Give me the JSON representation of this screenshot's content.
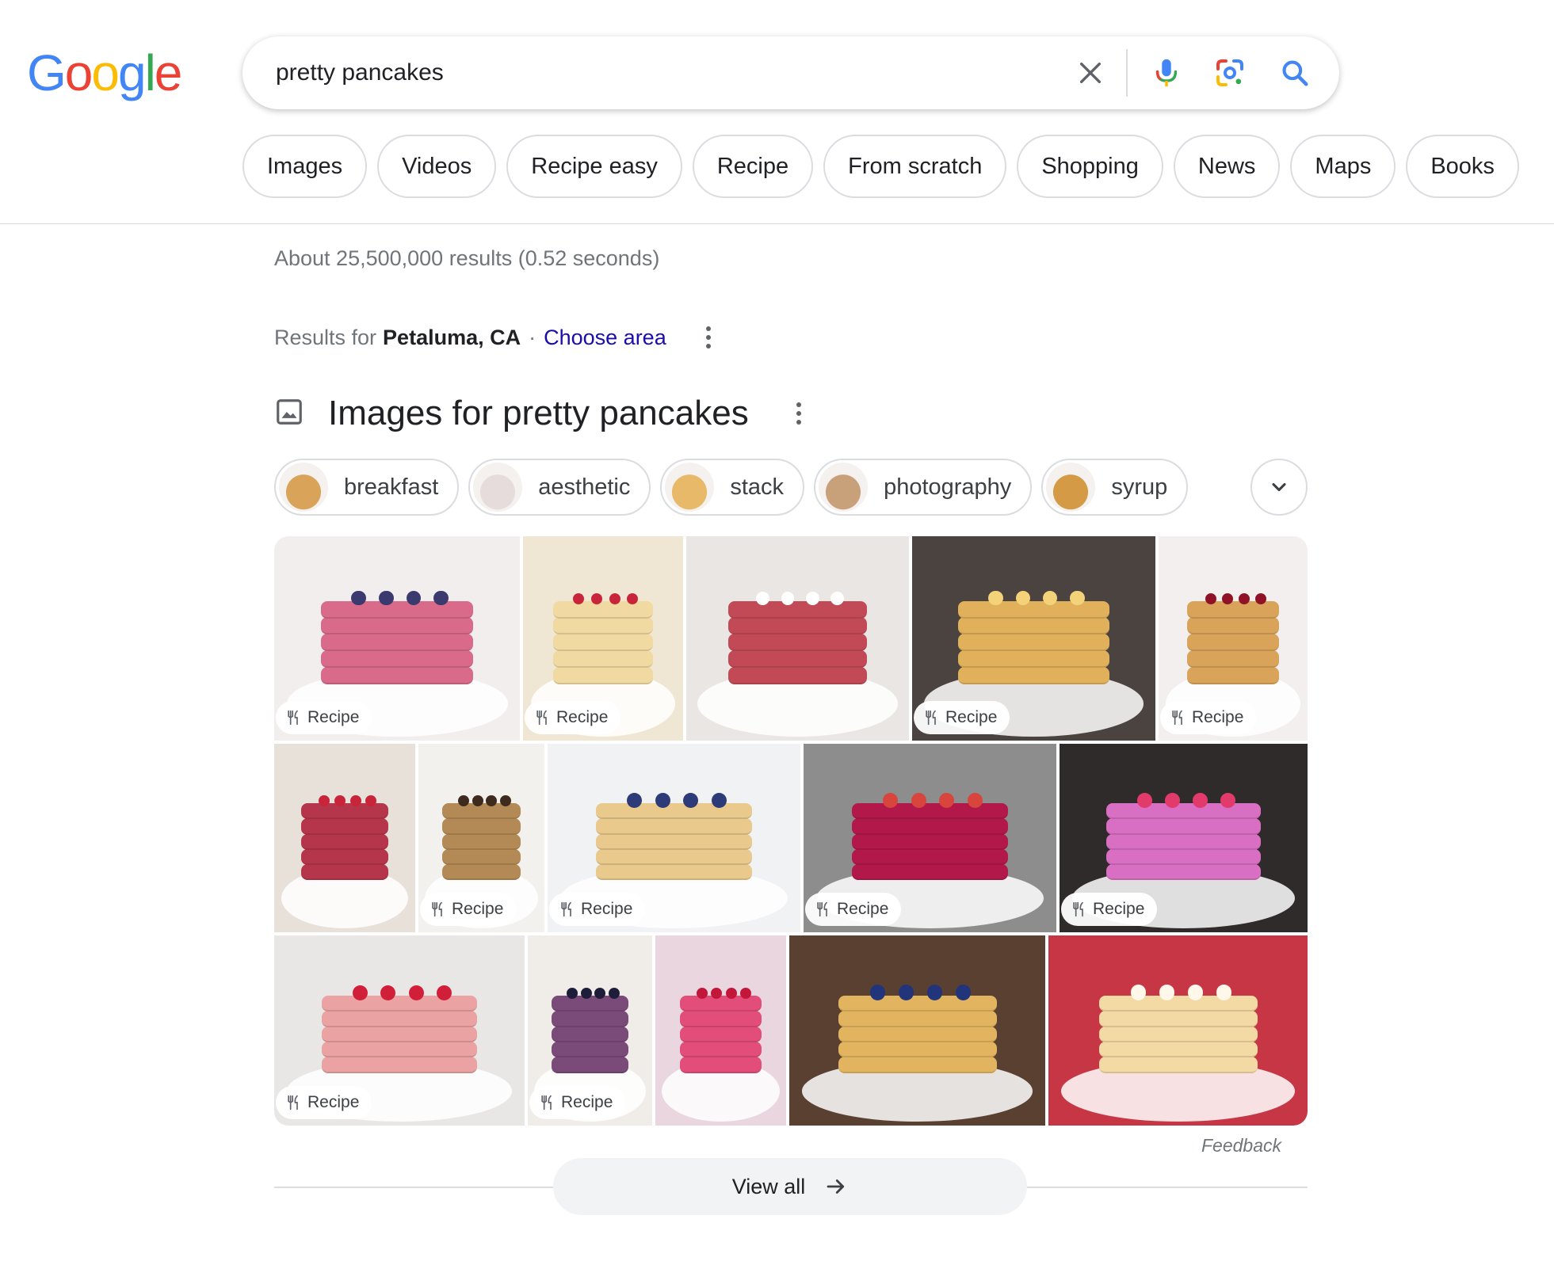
{
  "logo": {
    "letters": [
      "G",
      "o",
      "o",
      "g",
      "l",
      "e"
    ],
    "colors": [
      "#4285F4",
      "#EA4335",
      "#FBBC05",
      "#4285F4",
      "#34A853",
      "#EA4335"
    ]
  },
  "search": {
    "query": "pretty pancakes",
    "icons": [
      "close-icon",
      "mic-icon",
      "lens-icon",
      "search-icon"
    ]
  },
  "filters": [
    "Images",
    "Videos",
    "Recipe easy",
    "Recipe",
    "From scratch",
    "Shopping",
    "News",
    "Maps",
    "Books"
  ],
  "stats": "About 25,500,000 results (0.52 seconds)",
  "location": {
    "prefix": "Results for",
    "place": "Petaluma, CA",
    "separator": "·",
    "link": "Choose area"
  },
  "images_section": {
    "title": "Images for pretty pancakes",
    "refinements": [
      "breakfast",
      "aesthetic",
      "stack",
      "photography",
      "syrup"
    ],
    "badge_label": "Recipe",
    "tiles": [
      {
        "bg": "#f3eeee",
        "stack": "#d96a8a",
        "top": "#3b3a6e",
        "recipe": true
      },
      {
        "bg": "#efe6d4",
        "stack": "#f1d9a2",
        "top": "#c8243a",
        "recipe": true
      },
      {
        "bg": "#e9e6e4",
        "stack": "#c24a56",
        "top": "#ffffff",
        "recipe": false
      },
      {
        "bg": "#4b4340",
        "stack": "#e0b05a",
        "top": "#f4d27a",
        "recipe": true
      },
      {
        "bg": "#f2efee",
        "stack": "#d9a35a",
        "top": "#8f1226",
        "recipe": true
      },
      {
        "bg": "#e8e1da",
        "stack": "#b5364a",
        "top": "#c8243a",
        "recipe": false
      },
      {
        "bg": "#f3f1ee",
        "stack": "#b38a55",
        "top": "#3e2b1d",
        "recipe": true
      },
      {
        "bg": "#f1f2f4",
        "stack": "#e9c98c",
        "top": "#2d3c78",
        "recipe": true
      },
      {
        "bg": "#8d8d8d",
        "stack": "#b3184a",
        "top": "#d8453c",
        "recipe": true
      },
      {
        "bg": "#2f2b2b",
        "stack": "#d86fc3",
        "top": "#e23a6b",
        "recipe": true
      },
      {
        "bg": "#e9e6e6",
        "stack": "#eaa2a2",
        "top": "#d11f3a",
        "recipe": true
      },
      {
        "bg": "#f0ede8",
        "stack": "#7a4a78",
        "top": "#1f1e3a",
        "recipe": true
      },
      {
        "bg": "#e9d6df",
        "stack": "#e34d79",
        "top": "#c2163a",
        "recipe": false
      },
      {
        "bg": "#5a4030",
        "stack": "#e2b460",
        "top": "#23357a",
        "recipe": false
      },
      {
        "bg": "#c73645",
        "stack": "#f3d9a3",
        "top": "#fff8ea",
        "recipe": false
      }
    ]
  },
  "feedback": "Feedback",
  "view_all": "View all"
}
